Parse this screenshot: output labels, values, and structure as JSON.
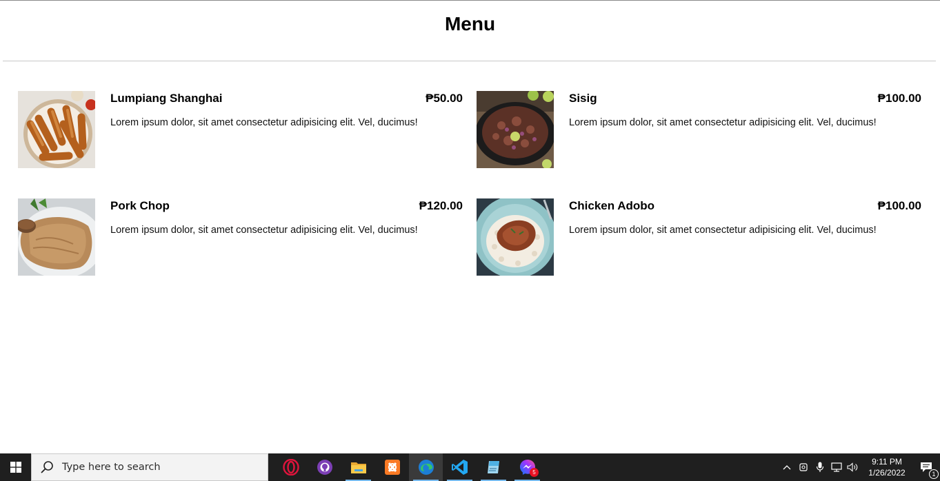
{
  "page": {
    "title": "Menu"
  },
  "menu": {
    "items": [
      {
        "name": "Lumpiang Shanghai",
        "price": "₱50.00",
        "description": "Lorem ipsum dolor, sit amet consectetur adipisicing elit. Vel, ducimus!",
        "image": "lumpia-photo"
      },
      {
        "name": "Sisig",
        "price": "₱100.00",
        "description": "Lorem ipsum dolor, sit amet consectetur adipisicing elit. Vel, ducimus!",
        "image": "sisig-photo"
      },
      {
        "name": "Pork Chop",
        "price": "₱120.00",
        "description": "Lorem ipsum dolor, sit amet consectetur adipisicing elit. Vel, ducimus!",
        "image": "pork-chop-photo"
      },
      {
        "name": "Chicken Adobo",
        "price": "₱100.00",
        "description": "Lorem ipsum dolor, sit amet consectetur adipisicing elit. Vel, ducimus!",
        "image": "chicken-adobo-photo"
      }
    ]
  },
  "taskbar": {
    "search_placeholder": "Type here to search",
    "apps": [
      "opera-icon",
      "github-desktop-icon",
      "file-explorer-icon",
      "xampp-icon",
      "edge-icon",
      "vscode-icon",
      "notepad-icon",
      "messenger-icon"
    ],
    "messenger_badge": "5",
    "clock": {
      "time": "9:11 PM",
      "date": "1/26/2022"
    },
    "notification_count": "1"
  },
  "colors": {
    "taskbar_bg": "#1f1f1f",
    "accent": "#76b9ed",
    "badge_red": "#e81123"
  }
}
